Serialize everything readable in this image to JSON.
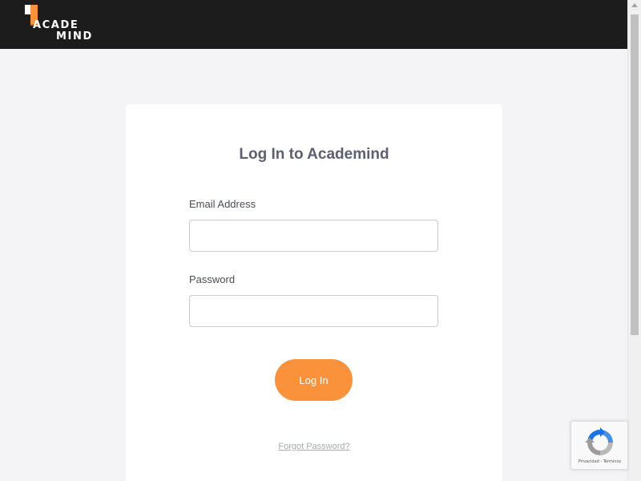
{
  "header": {
    "logo": {
      "line1": "ACADE",
      "line2": "MIND",
      "icon": "flag-logo-icon",
      "accent_color": "#fa923c"
    }
  },
  "login_card": {
    "title": "Log In to Academind",
    "email": {
      "label": "Email Address",
      "value": "",
      "placeholder": ""
    },
    "password": {
      "label": "Password",
      "value": "",
      "placeholder": ""
    },
    "submit_label": "Log In",
    "forgot_password_label": "Forgot Password?"
  },
  "recaptcha": {
    "icon": "recaptcha-icon",
    "privacy_label": "Privacidad",
    "separator": " - ",
    "terms_label": "Términos"
  },
  "colors": {
    "header_bg": "#1c1c1c",
    "page_bg": "#f4f4f6",
    "button_bg": "#fa923c",
    "title_text": "#5d6070"
  }
}
